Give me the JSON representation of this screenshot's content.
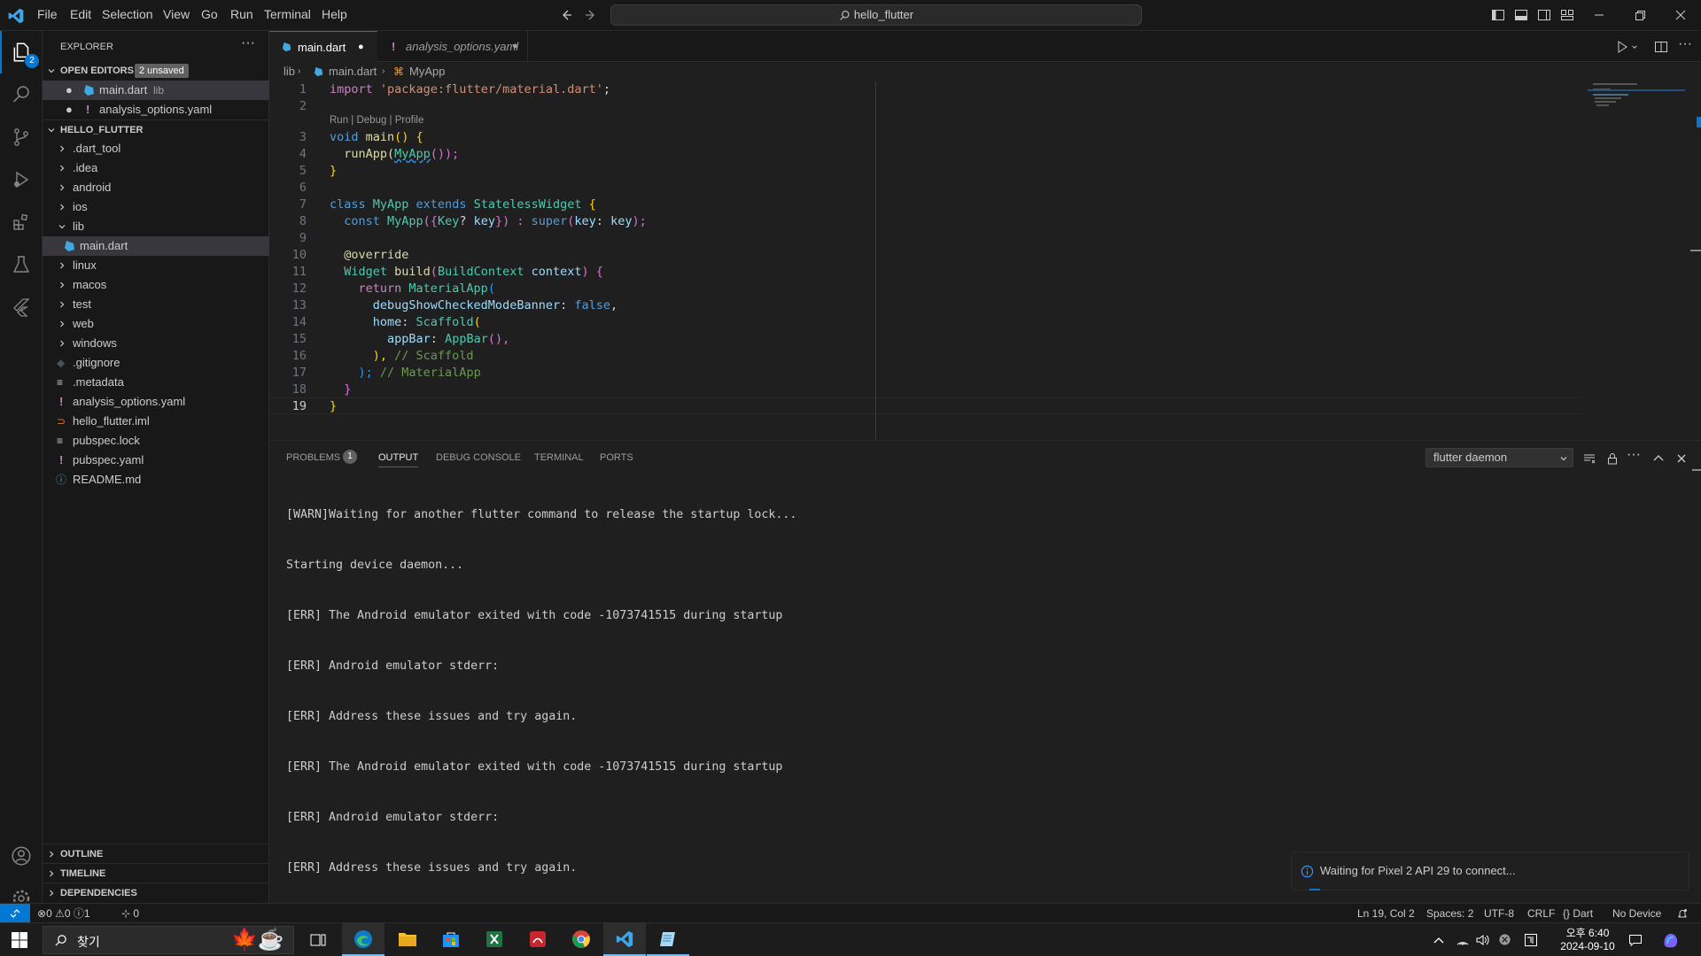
{
  "titlebar": {
    "menu": [
      "File",
      "Edit",
      "Selection",
      "View",
      "Go",
      "Run",
      "Terminal",
      "Help"
    ],
    "search": "hello_flutter"
  },
  "activity": {
    "badge": "2",
    "icons": [
      "explorer-icon",
      "search-icon",
      "source-control-icon",
      "run-debug-icon",
      "extensions-icon",
      "testing-icon",
      "flutter-icon"
    ]
  },
  "sidebar": {
    "title": "EXPLORER",
    "open_editors": {
      "label": "OPEN EDITORS",
      "badge": "2 unsaved"
    },
    "open_files": [
      {
        "name": "main.dart",
        "hint": "lib"
      },
      {
        "name": "analysis_options.yaml",
        "hint": ""
      }
    ],
    "project": "HELLO_FLUTTER",
    "tree": [
      {
        "name": ".dart_tool",
        "type": "folder"
      },
      {
        "name": ".idea",
        "type": "folder"
      },
      {
        "name": "android",
        "type": "folder"
      },
      {
        "name": "ios",
        "type": "folder"
      },
      {
        "name": "lib",
        "type": "folder-open"
      },
      {
        "name": "main.dart",
        "type": "dart"
      },
      {
        "name": "linux",
        "type": "folder"
      },
      {
        "name": "macos",
        "type": "folder"
      },
      {
        "name": "test",
        "type": "folder"
      },
      {
        "name": "web",
        "type": "folder"
      },
      {
        "name": "windows",
        "type": "folder"
      },
      {
        "name": ".gitignore",
        "type": "git"
      },
      {
        "name": ".metadata",
        "type": "meta"
      },
      {
        "name": "analysis_options.yaml",
        "type": "yaml"
      },
      {
        "name": "hello_flutter.iml",
        "type": "iml"
      },
      {
        "name": "pubspec.lock",
        "type": "meta"
      },
      {
        "name": "pubspec.yaml",
        "type": "yaml"
      },
      {
        "name": "README.md",
        "type": "info"
      }
    ],
    "bottom_sections": [
      "OUTLINE",
      "TIMELINE",
      "DEPENDENCIES"
    ]
  },
  "tabs": [
    {
      "name": "main.dart",
      "active": true
    },
    {
      "name": "analysis_options.yaml",
      "active": false
    }
  ],
  "breadcrumb": [
    "lib",
    "main.dart",
    "MyApp"
  ],
  "codelens": "Run | Debug | Profile",
  "code_lines": [
    "1",
    "2",
    "3",
    "4",
    "5",
    "6",
    "7",
    "8",
    "9",
    "10",
    "11",
    "12",
    "13",
    "14",
    "15",
    "16",
    "17",
    "18",
    "19"
  ],
  "code": {
    "l1a": "import ",
    "l1b": "'package:flutter/material.dart'",
    "l1c": ";",
    "l3a": "void ",
    "l3b": "main",
    "l3c": "() {",
    "l4a": "  runApp(",
    "l4b": "MyApp",
    "l4c": "());",
    "l5": "}",
    "l7a": "class ",
    "l7b": "MyApp",
    "l7c": " extends ",
    "l7d": "StatelessWidget",
    "l7e": " {",
    "l8a": "  const ",
    "l8b": "MyApp",
    "l8c": "({",
    "l8d": "Key",
    "l8e": "? ",
    "l8f": "key",
    "l8g": "}) : ",
    "l8h": "super",
    "l8i": "(",
    "l8j": "key",
    "l8k": ": ",
    "l8l": "key",
    "l8m": ");",
    "l10": "  @override",
    "l11a": "  Widget ",
    "l11b": "build",
    "l11c": "(",
    "l11d": "BuildContext",
    "l11e": " ",
    "l11f": "context",
    "l11g": ") {",
    "l12a": "    return ",
    "l12b": "MaterialApp",
    "l12c": "(",
    "l13a": "      debugShowCheckedModeBanner",
    "l13b": ": ",
    "l13c": "false",
    "l13d": ",",
    "l14a": "      home",
    "l14b": ": ",
    "l14c": "Scaffold",
    "l14d": "(",
    "l15a": "        appBar",
    "l15b": ": ",
    "l15c": "AppBar",
    "l15d": "(),",
    "l16a": "      ), ",
    "l16b": "// Scaffold",
    "l17a": "    ); ",
    "l17b": "// MaterialApp",
    "l18": "  }",
    "l19": "}"
  },
  "panel": {
    "tabs": [
      "PROBLEMS",
      "OUTPUT",
      "DEBUG CONSOLE",
      "TERMINAL",
      "PORTS"
    ],
    "problems_count": "1",
    "channel": "flutter daemon",
    "output": [
      "[WARN]Waiting for another flutter command to release the startup lock...",
      "Starting device daemon...",
      "[ERR] The Android emulator exited with code -1073741515 during startup",
      "[ERR] Android emulator stderr:",
      "[ERR] Address these issues and try again.",
      "[ERR] The Android emulator exited with code -1073741515 during startup",
      "[ERR] Android emulator stderr:",
      "[ERR] Address these issues and try again."
    ]
  },
  "notification": "Waiting for Pixel 2 API 29 to connect...",
  "status": {
    "errors": "0",
    "warnings": "0",
    "info": "1",
    "ports": "0",
    "position": "Ln 19, Col 2",
    "spaces": "Spaces: 2",
    "encoding": "UTF-8",
    "eol": "CRLF",
    "language": "Dart",
    "device": "No Device"
  },
  "taskbar": {
    "search": "찾기",
    "time": "오후 6:40",
    "date": "2024-09-10"
  },
  "colors": {
    "accent": "#0078d4",
    "background": "#1f1f1f",
    "chrome": "#181818"
  }
}
